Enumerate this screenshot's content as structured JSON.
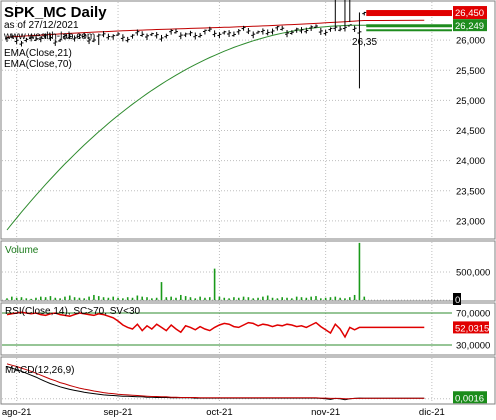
{
  "header": {
    "title": "SPK_MC Daily",
    "date_line": "as of 27/12/2021",
    "website": "www.wealth-lab.com"
  },
  "chart_data": [
    {
      "id": "price",
      "type": "bar",
      "subtype": "ohlc",
      "ylim": [
        22750,
        26600
      ],
      "yticks": [
        "23,000",
        "23,500",
        "24,000",
        "24,500",
        "25,000",
        "25,500",
        "26,000"
      ],
      "ytick_values": [
        23000,
        23500,
        24000,
        24500,
        25000,
        25500,
        26000
      ],
      "last_price_tag": "26,450",
      "ema_tag": "26,249",
      "price_annotation": "26,35",
      "colors": {
        "ema21": "#c00000",
        "ema70": "#2e8b2e",
        "bars": "#000000",
        "last_tag": "#e00000",
        "ema_tag": "#1e8c1e"
      },
      "series": [
        {
          "name": "EMA(Close,21)",
          "start": 26050,
          "end": 26330
        },
        {
          "name": "EMA(Close,70)",
          "start": 22850,
          "end": 26249
        }
      ],
      "ohlc_summary": {
        "range_main": [
          25950,
          26350
        ],
        "spike_high": 26850,
        "spike_low": 25200,
        "last": 26450
      }
    },
    {
      "id": "volume",
      "type": "bar",
      "label": "Volume",
      "ylim": [
        0,
        1000000
      ],
      "yticks": [
        "500,000",
        "0"
      ],
      "ytick_values": [
        500000,
        0
      ],
      "colors": {
        "bars": "#1a9a1a"
      },
      "values": [
        30000,
        60000,
        40000,
        50000,
        30000,
        20000,
        40000,
        60000,
        50000,
        70000,
        40000,
        30000,
        60000,
        80000,
        50000,
        40000,
        30000,
        60000,
        90000,
        70000,
        50000,
        40000,
        60000,
        40000,
        30000,
        50000,
        40000,
        80000,
        60000,
        50000,
        30000,
        40000,
        320000,
        50000,
        60000,
        40000,
        90000,
        70000,
        50000,
        30000,
        60000,
        40000,
        50000,
        560000,
        60000,
        40000,
        30000,
        50000,
        40000,
        60000,
        50000,
        30000,
        40000,
        60000,
        80000,
        40000,
        30000,
        50000,
        40000,
        30000,
        60000,
        50000,
        40000,
        60000,
        70000,
        30000,
        40000,
        50000,
        60000,
        40000,
        30000,
        50000,
        90000,
        1020000,
        60000
      ]
    },
    {
      "id": "rsi",
      "type": "line",
      "label": "RSI(Close,14), SC>70, SV<30",
      "ylim": [
        20,
        80
      ],
      "yticks": [
        "70,0000",
        "30,0000"
      ],
      "ytick_values": [
        70,
        30
      ],
      "last_tag": "52,0315",
      "colors": {
        "line": "#e00000",
        "bands": "#2e8b2e"
      },
      "values": [
        68,
        69,
        70,
        71,
        70,
        69,
        70,
        68,
        67,
        69,
        70,
        68,
        67,
        66,
        68,
        70,
        69,
        68,
        67,
        69,
        68,
        66,
        64,
        60,
        55,
        52,
        50,
        56,
        48,
        54,
        50,
        56,
        52,
        48,
        55,
        50,
        46,
        54,
        52,
        49,
        53,
        50,
        48,
        52,
        55,
        57,
        56,
        53,
        52,
        55,
        58,
        57,
        54,
        56,
        55,
        53,
        55,
        54,
        56,
        55,
        53,
        54,
        52,
        55,
        58,
        53,
        49,
        45,
        56,
        50,
        40,
        52,
        49,
        52,
        52
      ]
    },
    {
      "id": "macd",
      "type": "line",
      "label": "MACD(12,26,9)",
      "ylim": [
        -0.01,
        0.12
      ],
      "last_tag": "0,0016",
      "colors": {
        "macd": "#000000",
        "signal": "#c00000"
      },
      "series": [
        {
          "name": "MACD",
          "values": [
            0.1,
            0.095,
            0.09,
            0.085,
            0.079,
            0.073,
            0.067,
            0.06,
            0.053,
            0.047,
            0.042,
            0.037,
            0.033,
            0.029,
            0.026,
            0.023,
            0.02,
            0.018,
            0.016,
            0.014,
            0.012,
            0.011,
            0.01,
            0.009,
            0.008,
            0.008,
            0.007,
            0.006,
            0.006,
            0.005,
            0.005,
            0.004,
            0.004,
            0.004,
            0.003,
            0.003,
            0.003,
            0.003,
            0.003,
            0.002,
            0.002,
            0.002,
            0.002,
            0.002,
            0.002,
            0.002,
            0.002,
            0.002,
            0.002,
            0.002,
            0.002,
            0.002,
            0.002,
            0.002,
            0.002,
            0.002,
            0.002,
            0.002,
            0.002,
            0.002,
            0.002,
            0.002,
            0.002,
            0.002,
            0.002,
            0.001,
            0.0,
            -0.002,
            0.001,
            0.0,
            -0.003,
            0.0,
            0.001,
            0.002,
            0.0016
          ]
        },
        {
          "name": "Signal",
          "values": [
            0.108,
            0.104,
            0.1,
            0.095,
            0.09,
            0.085,
            0.079,
            0.073,
            0.067,
            0.061,
            0.056,
            0.05,
            0.046,
            0.041,
            0.037,
            0.033,
            0.03,
            0.027,
            0.024,
            0.022,
            0.019,
            0.017,
            0.016,
            0.014,
            0.013,
            0.012,
            0.011,
            0.01,
            0.009,
            0.008,
            0.007,
            0.007,
            0.006,
            0.006,
            0.005,
            0.005,
            0.004,
            0.004,
            0.004,
            0.004,
            0.003,
            0.003,
            0.003,
            0.003,
            0.003,
            0.003,
            0.003,
            0.003,
            0.003,
            0.003,
            0.003,
            0.003,
            0.003,
            0.003,
            0.003,
            0.003,
            0.003,
            0.003,
            0.003,
            0.003,
            0.003,
            0.003,
            0.003,
            0.003,
            0.003,
            0.002,
            0.002,
            0.001,
            0.001,
            0.001,
            0.0,
            0.0,
            0.001,
            0.001,
            0.0015
          ]
        }
      ]
    }
  ],
  "x_axis": {
    "labels": [
      "ago-21",
      "sep-21",
      "oct-21",
      "nov-21",
      "dic-21"
    ],
    "label_bar_index": [
      2,
      23,
      44,
      66,
      88
    ]
  }
}
